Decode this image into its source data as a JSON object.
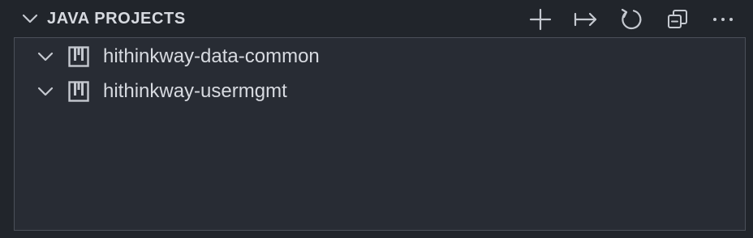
{
  "panel": {
    "title": "JAVA PROJECTS",
    "expanded": true
  },
  "actions": [
    {
      "name": "new-project",
      "icon": "plus-icon"
    },
    {
      "name": "import-project",
      "icon": "arrow-to-right-icon"
    },
    {
      "name": "refresh",
      "icon": "refresh-icon"
    },
    {
      "name": "collapse-all",
      "icon": "collapse-all-icon"
    },
    {
      "name": "more-actions",
      "icon": "ellipsis-icon"
    }
  ],
  "projects": [
    {
      "label": "hithinkway-data-common",
      "icon": "java-project-icon",
      "expanded": true
    },
    {
      "label": "hithinkway-usermgmt",
      "icon": "java-project-icon",
      "expanded": true
    }
  ],
  "colors": {
    "background": "#21252b",
    "tree_background": "#282c34",
    "border": "#4b5059",
    "text": "#d7dae0",
    "icon": "#c5c9d0"
  }
}
